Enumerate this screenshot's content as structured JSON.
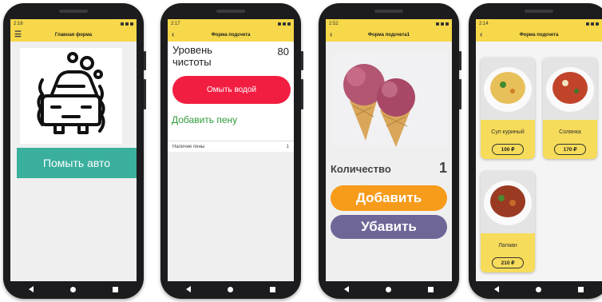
{
  "screens": [
    {
      "status_time": "2:16",
      "title": "Главная форма",
      "wash_button": "Помыть авто"
    },
    {
      "status_time": "2:17",
      "title": "Форма подсчета",
      "cleanliness_label": "Уровень чистоты",
      "cleanliness_value": "80",
      "wash_water_button": "Омыть водой",
      "add_foam_label": "Добавить пену",
      "foam_row_label": "Наличие пены",
      "foam_row_value": "1"
    },
    {
      "status_time": "2:52",
      "title": "Форма подсчета1",
      "quantity_label": "Количество",
      "quantity_value": "1",
      "add_button": "Добавить",
      "remove_button": "Убавить"
    },
    {
      "status_time": "2:14",
      "title": "Форма подсчета",
      "dishes": [
        {
          "name": "Суп куриный",
          "price": "100 ₽"
        },
        {
          "name": "Солянка",
          "price": "170 ₽"
        },
        {
          "name": "Лагман",
          "price": "210 ₽"
        }
      ]
    }
  ],
  "colors": {
    "appbar": "#f6d84a",
    "teal_button": "#3aaf9d",
    "red_button": "#f21e42",
    "green_text": "#2f9a3a",
    "orange_button": "#f79b1a",
    "purple_button": "#6f6698"
  },
  "icons": [
    "menu-icon",
    "back-icon",
    "car-wash-icon",
    "nav-back-icon",
    "nav-home-icon",
    "nav-recent-icon"
  ]
}
